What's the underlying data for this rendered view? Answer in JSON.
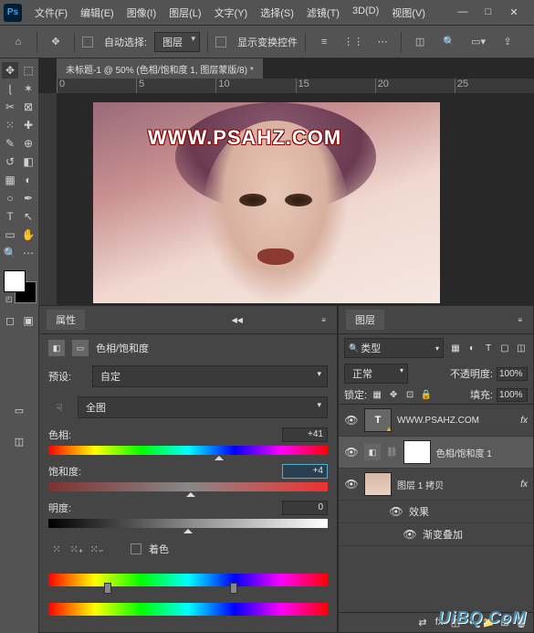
{
  "app": {
    "logo": "Ps"
  },
  "menu": [
    "文件(F)",
    "编辑(E)",
    "图像(I)",
    "图层(L)",
    "文字(Y)",
    "选择(S)",
    "滤镜(T)",
    "3D(D)",
    "视图(V)"
  ],
  "win": {
    "min": "—",
    "max": "□",
    "close": "✕"
  },
  "options": {
    "auto_select": "自动选择:",
    "target": "图层",
    "transform": "显示变换控件"
  },
  "doc": {
    "tab": "未标题-1 @ 50% (色相/饱和度 1, 图层蒙版/8) *"
  },
  "ruler": [
    "0",
    "5",
    "10",
    "15",
    "20",
    "25"
  ],
  "watermark": "WWW.PSAHZ.COM",
  "props": {
    "title": "属性",
    "adj_name": "色相/饱和度",
    "preset_label": "预设:",
    "preset_value": "自定",
    "range_value": "全图",
    "hue_label": "色相:",
    "hue_value": "+41",
    "sat_label": "饱和度:",
    "sat_value": "+4",
    "light_label": "明度:",
    "light_value": "0",
    "colorize": "着色"
  },
  "layers": {
    "title": "图层",
    "kind": "类型",
    "blend": "正常",
    "opacity_label": "不透明度:",
    "opacity_value": "100%",
    "lock_label": "锁定:",
    "fill_label": "填充:",
    "fill_value": "100%",
    "items": [
      {
        "name": "WWW.PSAHZ.COM",
        "fx": "fx"
      },
      {
        "name": "色相/饱和度 1"
      },
      {
        "name": "图层 1 拷贝",
        "fx": "fx"
      },
      {
        "effects": "效果"
      },
      {
        "gradient": "渐变叠加"
      }
    ]
  },
  "logo2": "UiBQ.CoM"
}
